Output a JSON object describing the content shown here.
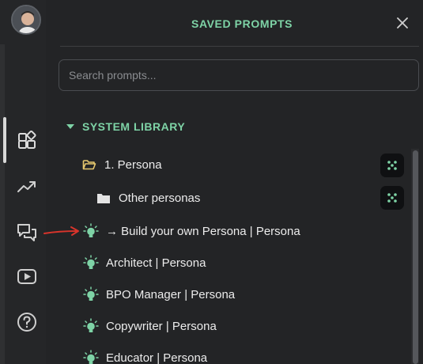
{
  "header": {
    "title": "SAVED PROMPTS"
  },
  "search": {
    "placeholder": "Search prompts..."
  },
  "library": {
    "title": "SYSTEM LIBRARY",
    "folder": "1. Persona",
    "subfolder": "Other personas",
    "prompts": [
      "→ Build your own Persona | Persona",
      "Architect | Persona",
      "BPO Manager | Persona",
      "Copywriter | Persona",
      "Educator | Persona"
    ]
  },
  "colors": {
    "accent": "#7ed3a6",
    "folder_icon": "#e6c86e",
    "annotation_arrow": "#d9342b",
    "background": "#232426"
  },
  "icons": {
    "rail": [
      "prompts-icon",
      "trending-icon",
      "chat-icon",
      "video-icon",
      "help-icon"
    ],
    "prompt": "lightbulb-icon",
    "close": "close-icon"
  }
}
